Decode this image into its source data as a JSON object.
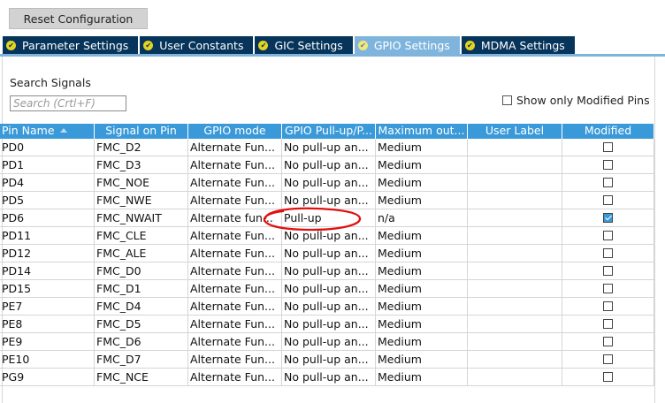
{
  "reset_button": "Reset Configuration",
  "tabs": [
    {
      "label": "Parameter Settings",
      "active": false
    },
    {
      "label": "User Constants",
      "active": false
    },
    {
      "label": "GIC Settings",
      "active": false
    },
    {
      "label": "GPIO Settings",
      "active": true
    },
    {
      "label": "MDMA Settings",
      "active": false
    }
  ],
  "search": {
    "label": "Search Signals",
    "placeholder": "Search (Crtl+F)",
    "value": ""
  },
  "show_modified": {
    "label": "Show only Modified Pins",
    "checked": false
  },
  "table": {
    "columns": [
      "Pin Name",
      "Signal on Pin",
      "GPIO mode",
      "GPIO Pull-up/P...",
      "Maximum out...",
      "User Label",
      "Modified"
    ],
    "sorted_column": "Pin Name",
    "rows": [
      {
        "pin": "PD0",
        "signal": "FMC_D2",
        "mode": "Alternate Fun...",
        "pull": "No pull-up an...",
        "speed": "Medium",
        "label": "",
        "modified": false
      },
      {
        "pin": "PD1",
        "signal": "FMC_D3",
        "mode": "Alternate Fun...",
        "pull": "No pull-up an...",
        "speed": "Medium",
        "label": "",
        "modified": false
      },
      {
        "pin": "PD4",
        "signal": "FMC_NOE",
        "mode": "Alternate Fun...",
        "pull": "No pull-up an...",
        "speed": "Medium",
        "label": "",
        "modified": false
      },
      {
        "pin": "PD5",
        "signal": "FMC_NWE",
        "mode": "Alternate Fun...",
        "pull": "No pull-up an...",
        "speed": "Medium",
        "label": "",
        "modified": false
      },
      {
        "pin": "PD6",
        "signal": "FMC_NWAIT",
        "mode": "Alternate fun...",
        "pull": "Pull-up",
        "speed": "n/a",
        "label": "",
        "modified": true
      },
      {
        "pin": "PD11",
        "signal": "FMC_CLE",
        "mode": "Alternate Fun...",
        "pull": "No pull-up an...",
        "speed": "Medium",
        "label": "",
        "modified": false
      },
      {
        "pin": "PD12",
        "signal": "FMC_ALE",
        "mode": "Alternate Fun...",
        "pull": "No pull-up an...",
        "speed": "Medium",
        "label": "",
        "modified": false
      },
      {
        "pin": "PD14",
        "signal": "FMC_D0",
        "mode": "Alternate Fun...",
        "pull": "No pull-up an...",
        "speed": "Medium",
        "label": "",
        "modified": false
      },
      {
        "pin": "PD15",
        "signal": "FMC_D1",
        "mode": "Alternate Fun...",
        "pull": "No pull-up an...",
        "speed": "Medium",
        "label": "",
        "modified": false
      },
      {
        "pin": "PE7",
        "signal": "FMC_D4",
        "mode": "Alternate Fun...",
        "pull": "No pull-up an...",
        "speed": "Medium",
        "label": "",
        "modified": false
      },
      {
        "pin": "PE8",
        "signal": "FMC_D5",
        "mode": "Alternate Fun...",
        "pull": "No pull-up an...",
        "speed": "Medium",
        "label": "",
        "modified": false
      },
      {
        "pin": "PE9",
        "signal": "FMC_D6",
        "mode": "Alternate Fun...",
        "pull": "No pull-up an...",
        "speed": "Medium",
        "label": "",
        "modified": false
      },
      {
        "pin": "PE10",
        "signal": "FMC_D7",
        "mode": "Alternate Fun...",
        "pull": "No pull-up an...",
        "speed": "Medium",
        "label": "",
        "modified": false
      },
      {
        "pin": "PG9",
        "signal": "FMC_NCE",
        "mode": "Alternate Fun...",
        "pull": "No pull-up an...",
        "speed": "Medium",
        "label": "",
        "modified": false
      }
    ]
  },
  "colors": {
    "tab_bg": "#06345a",
    "tab_active_bg": "#7fb5dd",
    "header_bg": "#3a9ad9",
    "check_icon": "#e3d422",
    "annotation": "#e01010"
  },
  "icons": {
    "tab_check": "check-circle-icon",
    "sort": "sort-ascending-icon",
    "annotation": "red-ellipse-annotation"
  }
}
